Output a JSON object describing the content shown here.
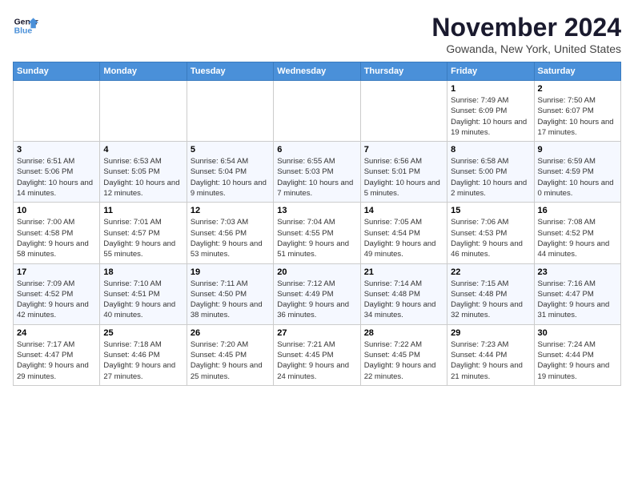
{
  "logo": {
    "line1": "General",
    "line2": "Blue"
  },
  "title": "November 2024",
  "location": "Gowanda, New York, United States",
  "weekdays": [
    "Sunday",
    "Monday",
    "Tuesday",
    "Wednesday",
    "Thursday",
    "Friday",
    "Saturday"
  ],
  "weeks": [
    [
      {
        "day": "",
        "info": ""
      },
      {
        "day": "",
        "info": ""
      },
      {
        "day": "",
        "info": ""
      },
      {
        "day": "",
        "info": ""
      },
      {
        "day": "",
        "info": ""
      },
      {
        "day": "1",
        "info": "Sunrise: 7:49 AM\nSunset: 6:09 PM\nDaylight: 10 hours and 19 minutes."
      },
      {
        "day": "2",
        "info": "Sunrise: 7:50 AM\nSunset: 6:07 PM\nDaylight: 10 hours and 17 minutes."
      }
    ],
    [
      {
        "day": "3",
        "info": "Sunrise: 6:51 AM\nSunset: 5:06 PM\nDaylight: 10 hours and 14 minutes."
      },
      {
        "day": "4",
        "info": "Sunrise: 6:53 AM\nSunset: 5:05 PM\nDaylight: 10 hours and 12 minutes."
      },
      {
        "day": "5",
        "info": "Sunrise: 6:54 AM\nSunset: 5:04 PM\nDaylight: 10 hours and 9 minutes."
      },
      {
        "day": "6",
        "info": "Sunrise: 6:55 AM\nSunset: 5:03 PM\nDaylight: 10 hours and 7 minutes."
      },
      {
        "day": "7",
        "info": "Sunrise: 6:56 AM\nSunset: 5:01 PM\nDaylight: 10 hours and 5 minutes."
      },
      {
        "day": "8",
        "info": "Sunrise: 6:58 AM\nSunset: 5:00 PM\nDaylight: 10 hours and 2 minutes."
      },
      {
        "day": "9",
        "info": "Sunrise: 6:59 AM\nSunset: 4:59 PM\nDaylight: 10 hours and 0 minutes."
      }
    ],
    [
      {
        "day": "10",
        "info": "Sunrise: 7:00 AM\nSunset: 4:58 PM\nDaylight: 9 hours and 58 minutes."
      },
      {
        "day": "11",
        "info": "Sunrise: 7:01 AM\nSunset: 4:57 PM\nDaylight: 9 hours and 55 minutes."
      },
      {
        "day": "12",
        "info": "Sunrise: 7:03 AM\nSunset: 4:56 PM\nDaylight: 9 hours and 53 minutes."
      },
      {
        "day": "13",
        "info": "Sunrise: 7:04 AM\nSunset: 4:55 PM\nDaylight: 9 hours and 51 minutes."
      },
      {
        "day": "14",
        "info": "Sunrise: 7:05 AM\nSunset: 4:54 PM\nDaylight: 9 hours and 49 minutes."
      },
      {
        "day": "15",
        "info": "Sunrise: 7:06 AM\nSunset: 4:53 PM\nDaylight: 9 hours and 46 minutes."
      },
      {
        "day": "16",
        "info": "Sunrise: 7:08 AM\nSunset: 4:52 PM\nDaylight: 9 hours and 44 minutes."
      }
    ],
    [
      {
        "day": "17",
        "info": "Sunrise: 7:09 AM\nSunset: 4:52 PM\nDaylight: 9 hours and 42 minutes."
      },
      {
        "day": "18",
        "info": "Sunrise: 7:10 AM\nSunset: 4:51 PM\nDaylight: 9 hours and 40 minutes."
      },
      {
        "day": "19",
        "info": "Sunrise: 7:11 AM\nSunset: 4:50 PM\nDaylight: 9 hours and 38 minutes."
      },
      {
        "day": "20",
        "info": "Sunrise: 7:12 AM\nSunset: 4:49 PM\nDaylight: 9 hours and 36 minutes."
      },
      {
        "day": "21",
        "info": "Sunrise: 7:14 AM\nSunset: 4:48 PM\nDaylight: 9 hours and 34 minutes."
      },
      {
        "day": "22",
        "info": "Sunrise: 7:15 AM\nSunset: 4:48 PM\nDaylight: 9 hours and 32 minutes."
      },
      {
        "day": "23",
        "info": "Sunrise: 7:16 AM\nSunset: 4:47 PM\nDaylight: 9 hours and 31 minutes."
      }
    ],
    [
      {
        "day": "24",
        "info": "Sunrise: 7:17 AM\nSunset: 4:47 PM\nDaylight: 9 hours and 29 minutes."
      },
      {
        "day": "25",
        "info": "Sunrise: 7:18 AM\nSunset: 4:46 PM\nDaylight: 9 hours and 27 minutes."
      },
      {
        "day": "26",
        "info": "Sunrise: 7:20 AM\nSunset: 4:45 PM\nDaylight: 9 hours and 25 minutes."
      },
      {
        "day": "27",
        "info": "Sunrise: 7:21 AM\nSunset: 4:45 PM\nDaylight: 9 hours and 24 minutes."
      },
      {
        "day": "28",
        "info": "Sunrise: 7:22 AM\nSunset: 4:45 PM\nDaylight: 9 hours and 22 minutes."
      },
      {
        "day": "29",
        "info": "Sunrise: 7:23 AM\nSunset: 4:44 PM\nDaylight: 9 hours and 21 minutes."
      },
      {
        "day": "30",
        "info": "Sunrise: 7:24 AM\nSunset: 4:44 PM\nDaylight: 9 hours and 19 minutes."
      }
    ]
  ]
}
